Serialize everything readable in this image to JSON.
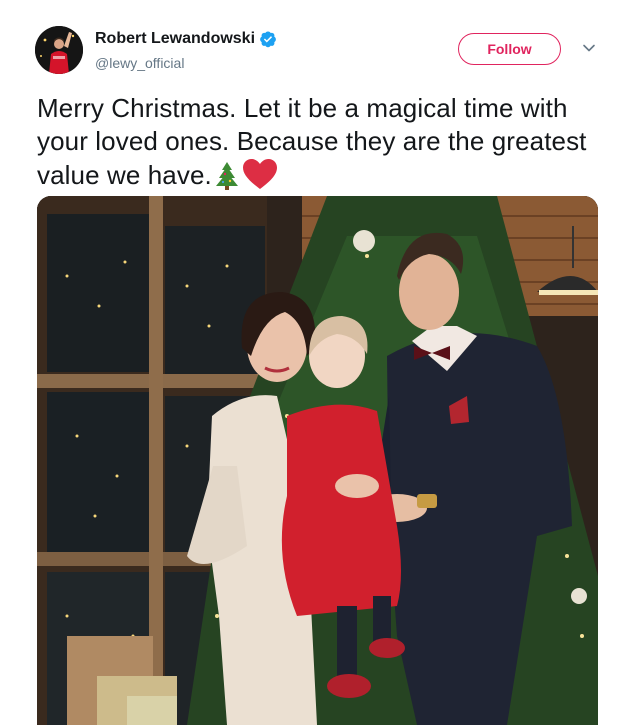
{
  "author": {
    "display_name": "Robert Lewandowski",
    "handle": "@lewy_official",
    "verified": true,
    "verified_icon": "verified-badge-icon",
    "avatar_icon": "avatar-photo"
  },
  "actions": {
    "follow_label": "Follow",
    "more_icon": "chevron-down-icon"
  },
  "tweet": {
    "text": "Merry Christmas. Let it be a magical time with your loved ones. Because they are the greatest value we have.",
    "emojis": [
      "christmas-tree-icon",
      "red-heart-icon"
    ]
  },
  "media": {
    "type": "photo",
    "icon": "christmas-family-photo"
  },
  "colors": {
    "accent": "#e0245e",
    "verified_blue": "#1da1f2",
    "text": "#14171a",
    "muted": "#657786"
  }
}
